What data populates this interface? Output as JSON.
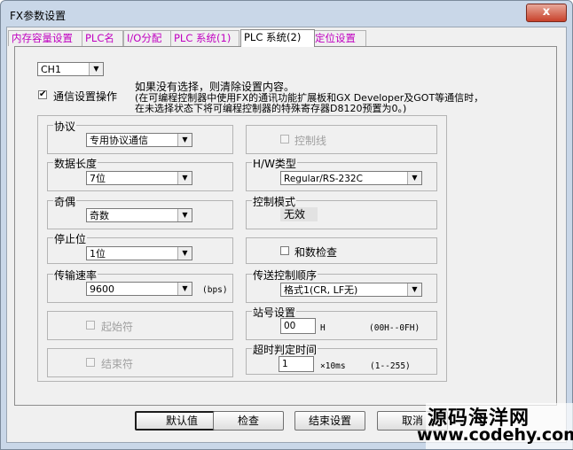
{
  "window": {
    "title": "FX参数设置",
    "close_glyph": "x"
  },
  "tabs": [
    {
      "label": "内存容量设置"
    },
    {
      "label": "PLC名"
    },
    {
      "label": "I/O分配"
    },
    {
      "label": "PLC 系统(1)"
    },
    {
      "label": "PLC 系统(2)"
    },
    {
      "label": "定位设置"
    }
  ],
  "active_tab": "PLC 系统(2)",
  "channel": {
    "value": "CH1"
  },
  "comm_setting": {
    "checked": true,
    "label": "通信设置操作",
    "note1": "如果没有选择，则清除设置内容。",
    "note2": "(在可编程控制器中使用FX的通讯功能扩展板和GX Developer及GOT等通信时，",
    "note3": "在未选择状态下将可编程控制器的特殊寄存器D8120预置为0。)"
  },
  "protocol": {
    "label": "协议",
    "value": "专用协议通信"
  },
  "data_length": {
    "label": "数据长度",
    "value": "7位"
  },
  "parity": {
    "label": "奇偶",
    "value": "奇数"
  },
  "stop_bit": {
    "label": "停止位",
    "value": "1位"
  },
  "baud_rate": {
    "label": "传输速率",
    "value": "9600",
    "unit": "(bps)"
  },
  "start_char": {
    "label": "起始符",
    "checked": false,
    "enabled": false
  },
  "end_char": {
    "label": "结束符",
    "checked": false,
    "enabled": false
  },
  "control_line": {
    "label": "控制线",
    "checked": false,
    "enabled": false
  },
  "hw_type": {
    "label": "H/W类型",
    "value": "Regular/RS-232C"
  },
  "control_mode": {
    "label": "控制模式",
    "value": "无效"
  },
  "checksum": {
    "label": "和数检查",
    "checked": false
  },
  "transmit_sequence": {
    "label": "传送控制顺序",
    "value": "格式1(CR, LF无)"
  },
  "station": {
    "label": "站号设置",
    "value": "00",
    "unit": "H",
    "range": "(00H--0FH)"
  },
  "timeout": {
    "label": "超时判定时间",
    "value": "1",
    "unit": "×10ms",
    "range": "(1--255)"
  },
  "buttons": {
    "default": "默认值",
    "check": "检查",
    "finish": "结束设置",
    "cancel": "取消"
  },
  "watermark": {
    "line1": "源码海洋网",
    "line2": "www.codehy.com"
  },
  "colors": {
    "tab_text": "#c000c0",
    "frame": "#c9d7e8",
    "close": "#c8412a"
  },
  "icons": {
    "dropdown": "chevron-down-icon",
    "check": "checkmark-icon"
  }
}
